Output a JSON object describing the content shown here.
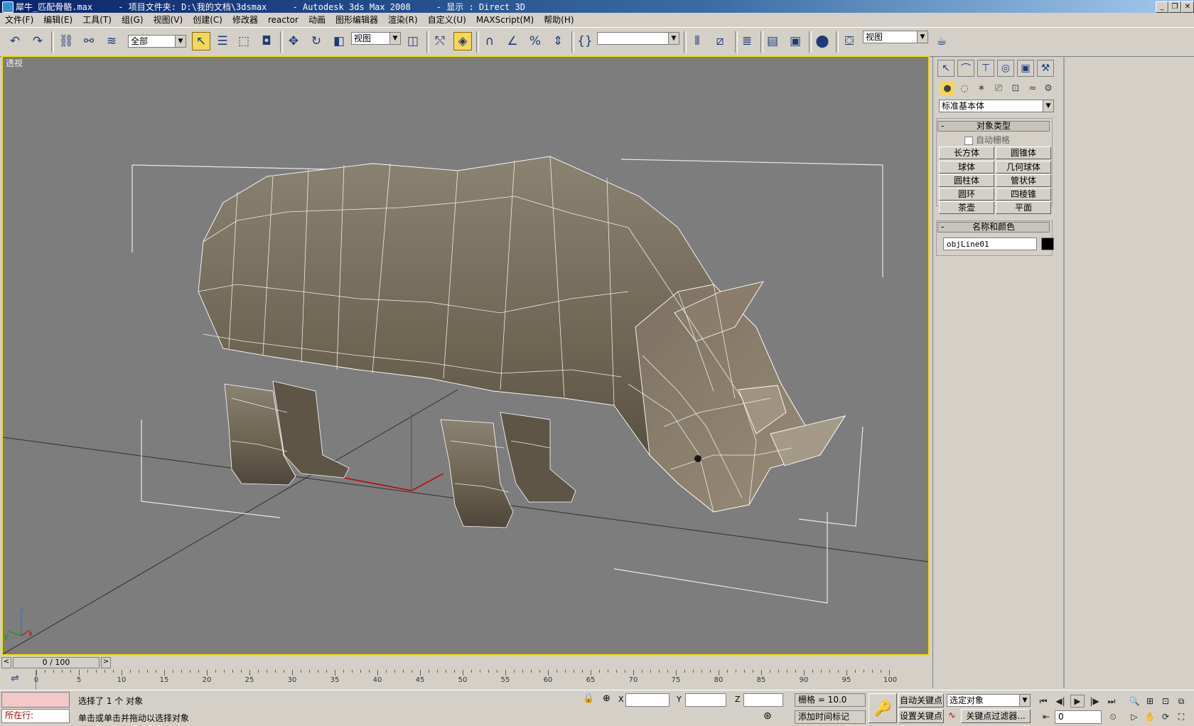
{
  "window": {
    "title": "犀牛_匹配骨骼.max     - 项目文件夹: D:\\我的文档\\3dsmax     - Autodesk 3ds Max 2008     - 显示 : Direct 3D",
    "controls": [
      "_",
      "❐",
      "✕"
    ]
  },
  "menu": [
    "文件(F)",
    "编辑(E)",
    "工具(T)",
    "组(G)",
    "视图(V)",
    "创建(C)",
    "修改器",
    "reactor",
    "动画",
    "图形编辑器",
    "渲染(R)",
    "自定义(U)",
    "MAXScript(M)",
    "帮助(H)"
  ],
  "toolbar": {
    "selection_filter": "全部",
    "ref_coord": "视图",
    "named_selection": "",
    "render_view": "视图"
  },
  "viewport": {
    "label": "透视",
    "axis_labels": {
      "x": "x",
      "y": "y",
      "z": "z"
    },
    "colors": {
      "background": "#7d7d7d",
      "active_border": "#f0e000",
      "wire": "#ffffff",
      "skin": "#7a6e5a"
    }
  },
  "command_panel": {
    "category": "标准基本体",
    "object_type": {
      "title": "对象类型",
      "autogrid": "自动栅格",
      "buttons": [
        "长方体",
        "圆锥体",
        "球体",
        "几何球体",
        "圆柱体",
        "管状体",
        "圆环",
        "四棱锥",
        "茶壶",
        "平面"
      ]
    },
    "name_color": {
      "title": "名称和颜色",
      "name": "objLine01",
      "color": "#000000"
    }
  },
  "timeline": {
    "frame_display": "0 / 100",
    "ticks": [
      "0",
      "5",
      "10",
      "15",
      "20",
      "25",
      "30",
      "35",
      "40",
      "45",
      "50",
      "55",
      "60",
      "65",
      "70",
      "75",
      "80",
      "85",
      "90",
      "95",
      "100"
    ]
  },
  "status": {
    "maxscript_listener": "所在行:",
    "selection_info": "选择了 1 个 对象",
    "prompt": "单击或单击并拖动以选择对象",
    "x_label": "X",
    "y_label": "Y",
    "z_label": "Z",
    "grid": "栅格 = 10.0",
    "add_time_tag": "添加时间标记",
    "auto_key": "自动关键点",
    "set_key": "设置关键点",
    "key_mode": "选定对象",
    "key_filters": "关键点过滤器...",
    "current_frame": "0"
  }
}
